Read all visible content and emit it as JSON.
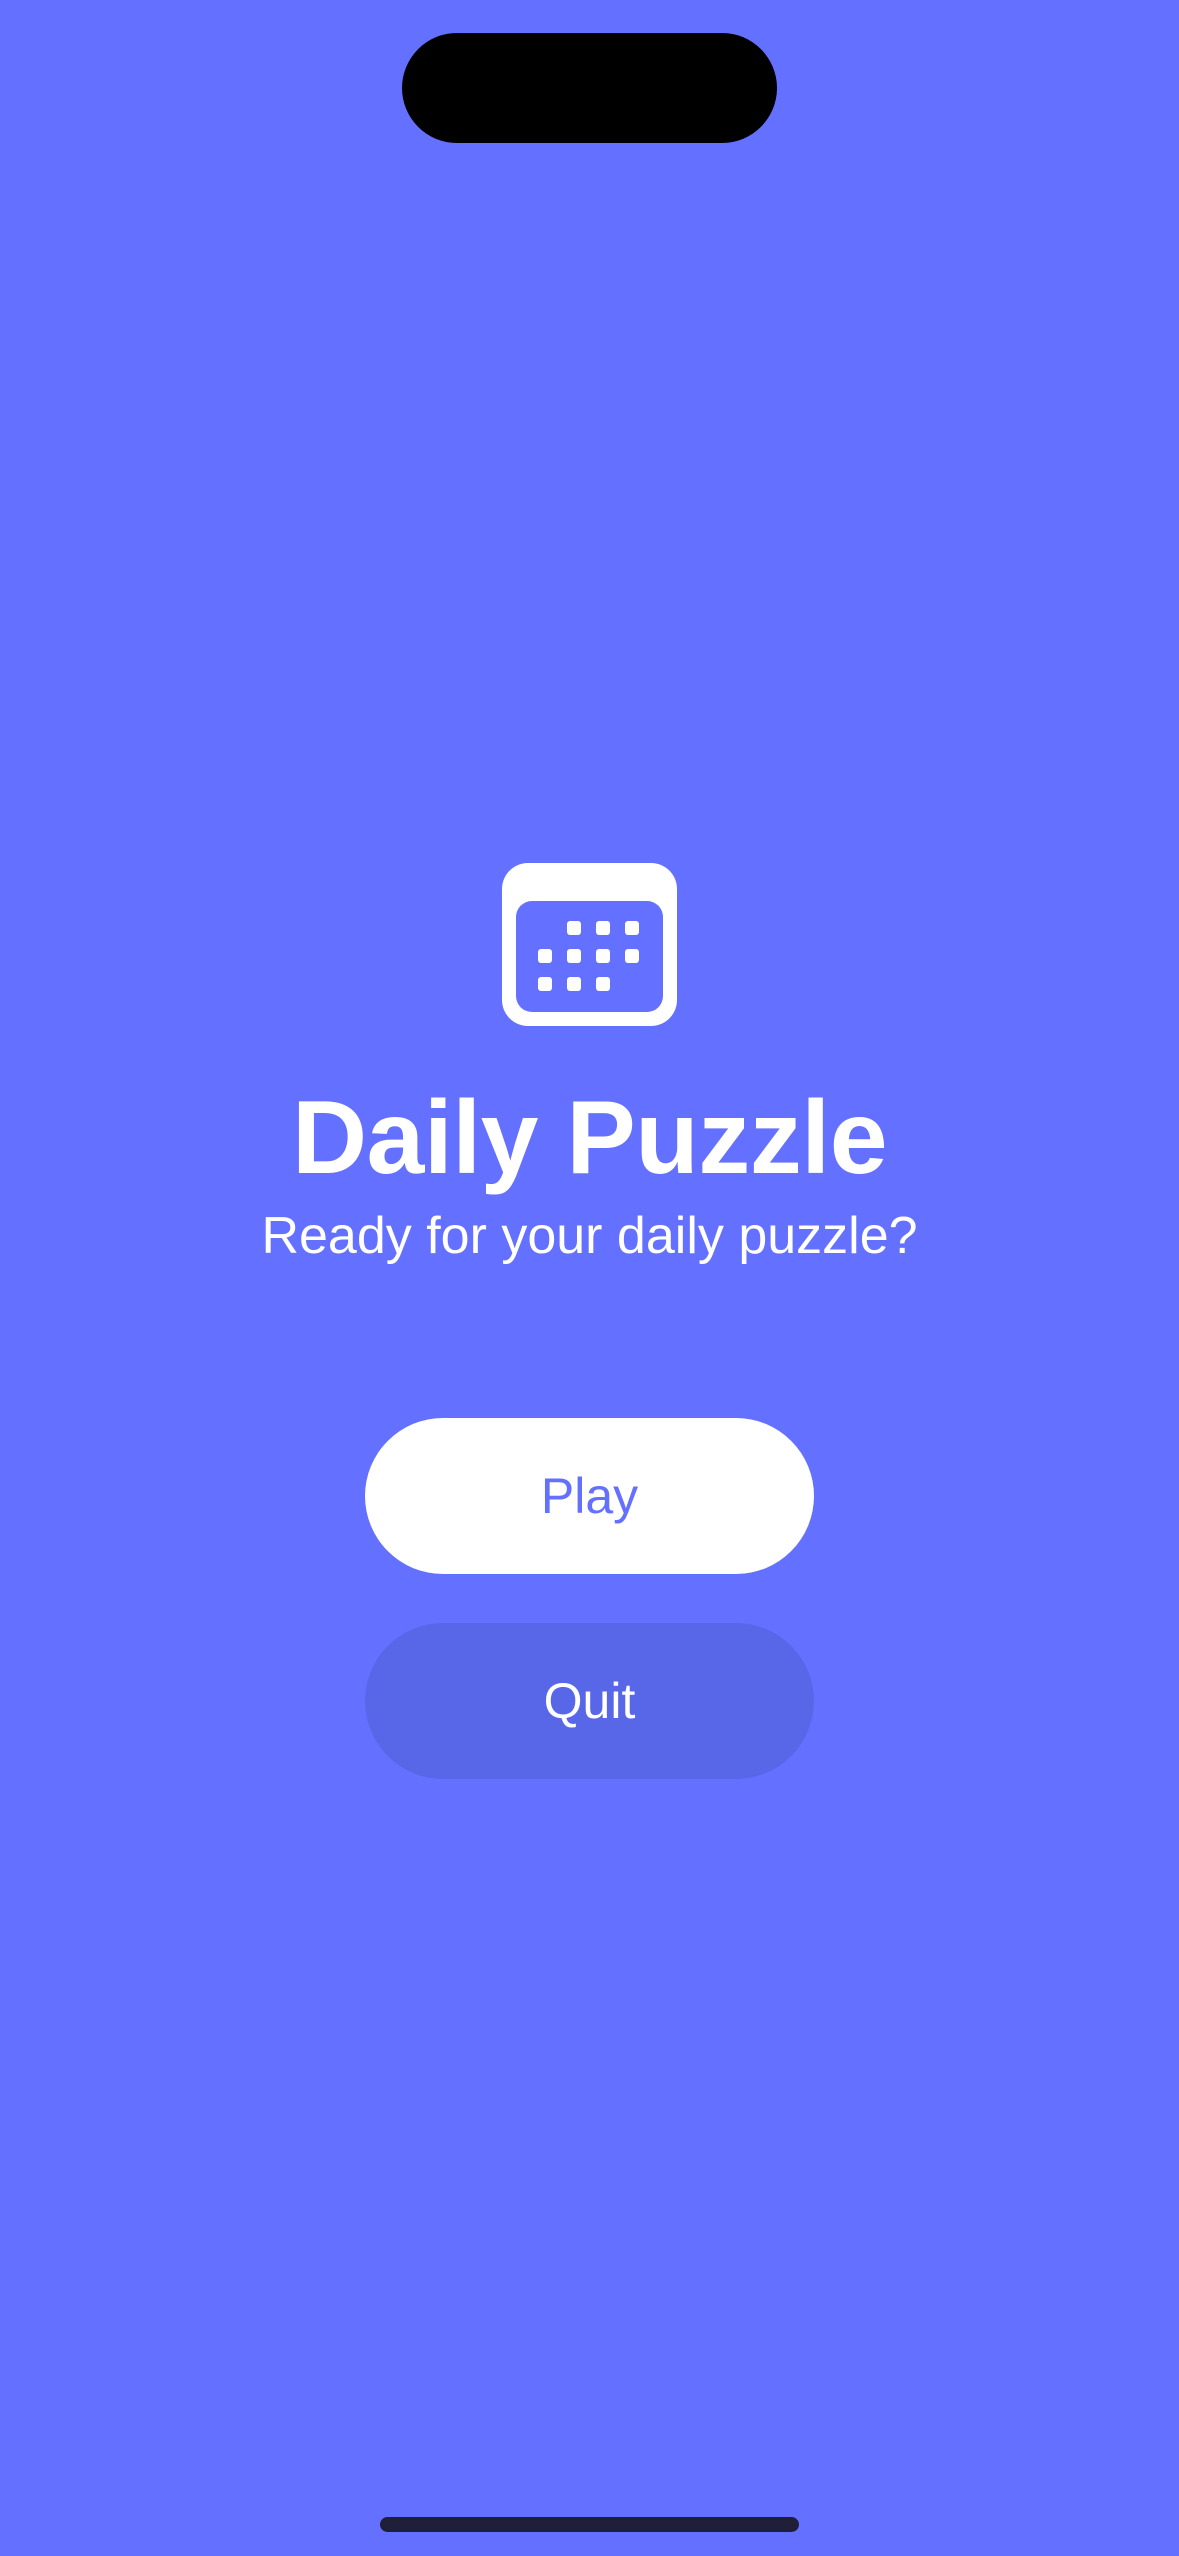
{
  "app": {
    "title": "Daily Puzzle",
    "subtitle": "Ready for your daily puzzle?",
    "icon": "calendar-icon"
  },
  "actions": {
    "play_label": "Play",
    "quit_label": "Quit"
  },
  "colors": {
    "background": "#6470ff",
    "primary_button_bg": "#ffffff",
    "primary_button_text": "#6470ff",
    "secondary_button_bg": "#5867e8",
    "secondary_button_text": "#ffffff"
  }
}
